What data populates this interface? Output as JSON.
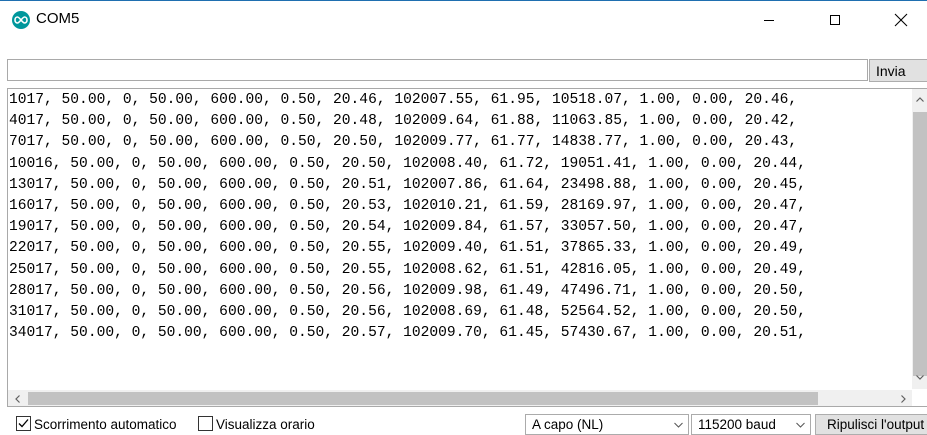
{
  "window": {
    "title": "COM5"
  },
  "send": {
    "input_value": "",
    "button_label": "Invia"
  },
  "output": {
    "lines": [
      "1017, 50.00, 0, 50.00, 600.00, 0.50, 20.46, 102007.55, 61.95, 10518.07, 1.00, 0.00, 20.46,",
      "4017, 50.00, 0, 50.00, 600.00, 0.50, 20.48, 102009.64, 61.88, 11063.85, 1.00, 0.00, 20.42,",
      "7017, 50.00, 0, 50.00, 600.00, 0.50, 20.50, 102009.77, 61.77, 14838.77, 1.00, 0.00, 20.43,",
      "10016, 50.00, 0, 50.00, 600.00, 0.50, 20.50, 102008.40, 61.72, 19051.41, 1.00, 0.00, 20.44,",
      "13017, 50.00, 0, 50.00, 600.00, 0.50, 20.51, 102007.86, 61.64, 23498.88, 1.00, 0.00, 20.45,",
      "16017, 50.00, 0, 50.00, 600.00, 0.50, 20.53, 102010.21, 61.59, 28169.97, 1.00, 0.00, 20.47,",
      "19017, 50.00, 0, 50.00, 600.00, 0.50, 20.54, 102009.84, 61.57, 33057.50, 1.00, 0.00, 20.47,",
      "22017, 50.00, 0, 50.00, 600.00, 0.50, 20.55, 102009.40, 61.51, 37865.33, 1.00, 0.00, 20.49,",
      "25017, 50.00, 0, 50.00, 600.00, 0.50, 20.55, 102008.62, 61.51, 42816.05, 1.00, 0.00, 20.49,",
      "28017, 50.00, 0, 50.00, 600.00, 0.50, 20.56, 102009.98, 61.49, 47496.71, 1.00, 0.00, 20.50,",
      "31017, 50.00, 0, 50.00, 600.00, 0.50, 20.56, 102008.69, 61.48, 52564.52, 1.00, 0.00, 20.50,",
      "34017, 50.00, 0, 50.00, 600.00, 0.50, 20.57, 102009.70, 61.45, 57430.67, 1.00, 0.00, 20.51,"
    ]
  },
  "footer": {
    "autoscroll": {
      "label": "Scorrimento automatico",
      "checked": true
    },
    "timestamp": {
      "label": "Visualizza orario",
      "checked": false
    },
    "line_ending": "A capo (NL)",
    "baud_rate": "115200 baud",
    "clear_button": "Ripulisci l'output"
  },
  "icons": {
    "app": "arduino-infinity-icon",
    "minimize": "minimize-icon",
    "maximize": "maximize-icon",
    "close": "close-icon"
  },
  "colors": {
    "app_icon": "#00979c",
    "window_border": "#1f6fb0"
  }
}
